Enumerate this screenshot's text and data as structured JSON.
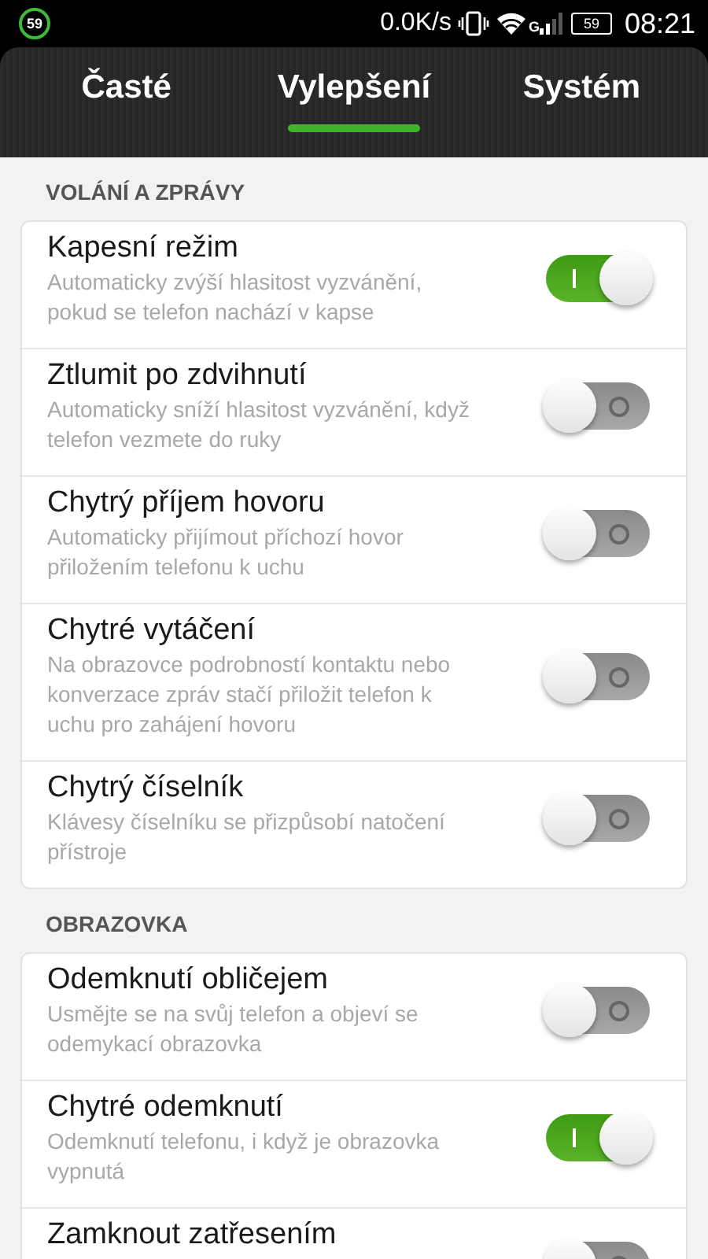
{
  "status_bar": {
    "badge": "59",
    "speed": "0.0K/s",
    "network": "G",
    "battery": "59",
    "time": "08:21"
  },
  "tabs": [
    {
      "label": "Časté",
      "selected": false
    },
    {
      "label": "Vylepšení",
      "selected": true
    },
    {
      "label": "Systém",
      "selected": false
    }
  ],
  "sections": [
    {
      "title": "VOLÁNÍ A ZPRÁVY",
      "items": [
        {
          "title": "Kapesní režim",
          "description": "Automaticky zvýší hlasitost vyzvánění, pokud se telefon nachází v kapse",
          "on": true
        },
        {
          "title": "Ztlumit po zdvihnutí",
          "description": "Automaticky sníží hlasitost vyzvánění, když telefon vezmete do ruky",
          "on": false
        },
        {
          "title": "Chytrý příjem hovoru",
          "description": "Automaticky přijímout příchozí hovor přiložením telefonu k uchu",
          "on": false
        },
        {
          "title": "Chytré vytáčení",
          "description": "Na obrazovce podrobností kontaktu nebo konverzace zpráv stačí přiložit telefon k uchu pro zahájení hovoru",
          "on": false
        },
        {
          "title": "Chytrý číselník",
          "description": "Klávesy číselníku se přizpůsobí natočení přístroje",
          "on": false
        }
      ]
    },
    {
      "title": "OBRAZOVKA",
      "items": [
        {
          "title": "Odemknutí obličejem",
          "description": "Usmějte se na svůj telefon a objeví se odemykací obrazovka",
          "on": false
        },
        {
          "title": "Chytré odemknutí",
          "description": "Odemknutí telefonu, i když je obrazovka vypnutá",
          "on": true
        },
        {
          "title": "Zamknout zatřesením",
          "on": false
        }
      ]
    }
  ]
}
